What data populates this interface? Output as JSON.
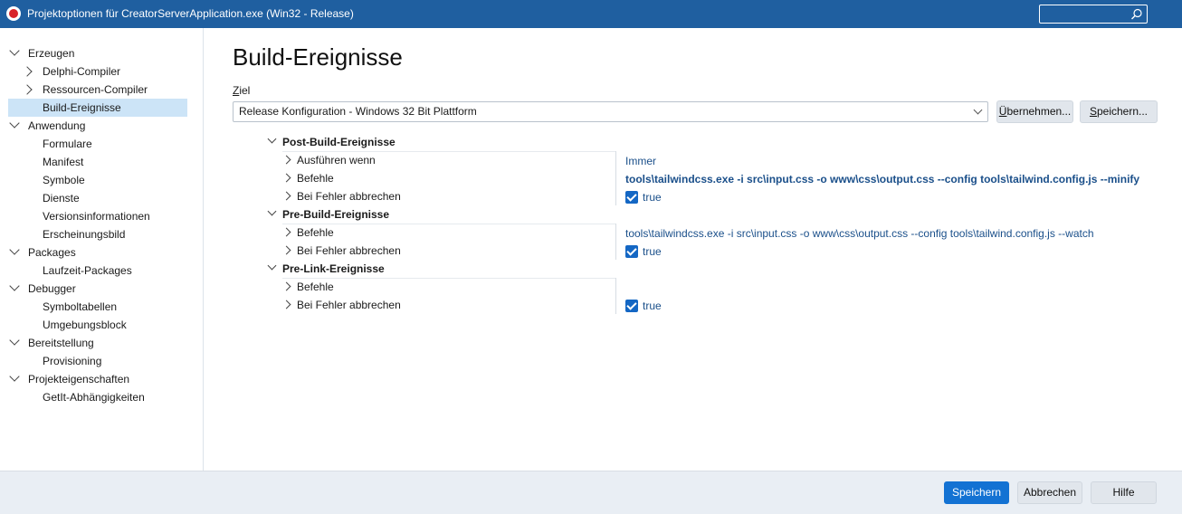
{
  "window": {
    "title": "Projektoptionen für CreatorServerApplication.exe  (Win32 - Release)",
    "search_placeholder": ""
  },
  "sidebar": {
    "items": [
      {
        "label": "Erzeugen",
        "level": 0,
        "expanded": true
      },
      {
        "label": "Delphi-Compiler",
        "level": 1,
        "expandable": true
      },
      {
        "label": "Ressourcen-Compiler",
        "level": 1,
        "expandable": true
      },
      {
        "label": "Build-Ereignisse",
        "level": 1,
        "selected": true
      },
      {
        "label": "Anwendung",
        "level": 0,
        "expanded": true
      },
      {
        "label": "Formulare",
        "level": 1
      },
      {
        "label": "Manifest",
        "level": 1
      },
      {
        "label": "Symbole",
        "level": 1
      },
      {
        "label": "Dienste",
        "level": 1
      },
      {
        "label": "Versionsinformationen",
        "level": 1
      },
      {
        "label": "Erscheinungsbild",
        "level": 1
      },
      {
        "label": "Packages",
        "level": 0,
        "expanded": true
      },
      {
        "label": "Laufzeit-Packages",
        "level": 1
      },
      {
        "label": "Debugger",
        "level": 0,
        "expanded": true
      },
      {
        "label": "Symboltabellen",
        "level": 1
      },
      {
        "label": "Umgebungsblock",
        "level": 1
      },
      {
        "label": "Bereitstellung",
        "level": 0,
        "expanded": true
      },
      {
        "label": "Provisioning",
        "level": 1
      },
      {
        "label": "Projekteigenschaften",
        "level": 0,
        "expanded": true
      },
      {
        "label": "GetIt-Abhängigkeiten",
        "level": 1
      }
    ]
  },
  "main": {
    "title": "Build-Ereignisse",
    "ziel_label_first": "Z",
    "ziel_label_rest": "iel",
    "ziel_value": "Release Konfiguration - Windows 32 Bit Plattform",
    "apply_first": "Ü",
    "apply_rest": "bernehmen...",
    "save_first": "S",
    "save_rest": "peichern..."
  },
  "grid": {
    "post_build": {
      "title": "Post-Build-Ereignisse",
      "run_when_label": "Ausführen wenn",
      "run_when_value": "Immer",
      "commands_label": "Befehle",
      "commands_value": "tools\\tailwindcss.exe -i src\\input.css -o www\\css\\output.css --config tools\\tailwind.config.js --minify",
      "cancel_on_error_label": "Bei Fehler abbrechen",
      "cancel_on_error_value": "true"
    },
    "pre_build": {
      "title": "Pre-Build-Ereignisse",
      "commands_label": "Befehle",
      "commands_value": "tools\\tailwindcss.exe -i src\\input.css -o www\\css\\output.css --config tools\\tailwind.config.js --watch",
      "cancel_on_error_label": "Bei Fehler abbrechen",
      "cancel_on_error_value": "true"
    },
    "pre_link": {
      "title": "Pre-Link-Ereignisse",
      "commands_label": "Befehle",
      "commands_value": "",
      "cancel_on_error_label": "Bei Fehler abbrechen",
      "cancel_on_error_value": "true"
    }
  },
  "footer": {
    "save": "Speichern",
    "cancel": "Abbrechen",
    "help": "Hilfe"
  },
  "colors": {
    "titlebar": "#1f5fa0",
    "accent": "#1372d3",
    "selection": "#cce4f7",
    "value_text": "#1a4f8a"
  }
}
